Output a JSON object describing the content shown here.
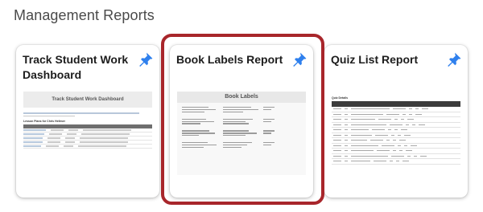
{
  "page": {
    "title": "Management Reports"
  },
  "cards": [
    {
      "title": "Track Student Work Dashboard",
      "icon": "pin-icon",
      "thumbnail": {
        "banner": "Track Student Work Dashboard",
        "table_label": "Lesson Plans for Chris Hellmer"
      }
    },
    {
      "title": "Book Labels Report",
      "icon": "pin-icon",
      "selected": true,
      "thumbnail": {
        "banner": "Book Labels"
      }
    },
    {
      "title": "Quiz List Report",
      "icon": "pin-icon",
      "thumbnail": {
        "table_label": "Quiz Details"
      }
    }
  ],
  "colors": {
    "pin": "#2f80ed",
    "highlight": "#a8262b"
  }
}
